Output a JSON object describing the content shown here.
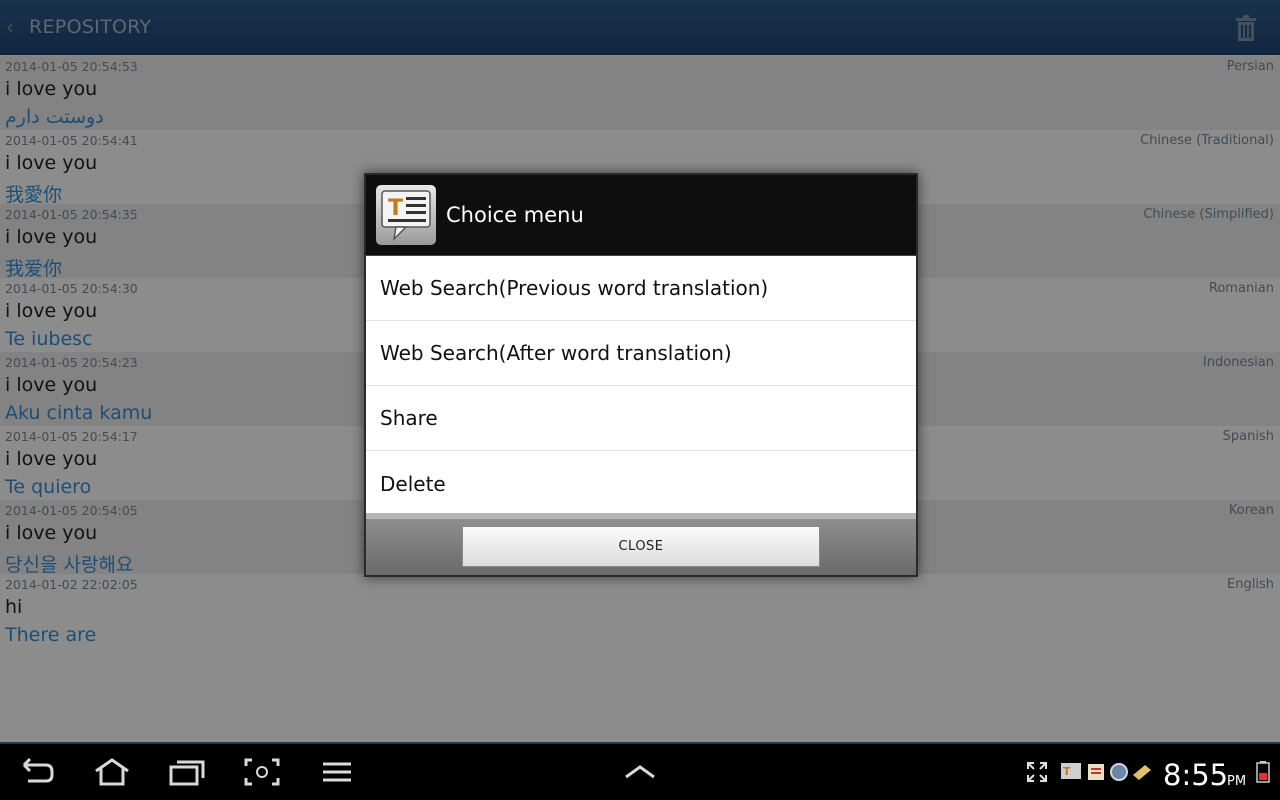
{
  "action_bar": {
    "title": "REPOSITORY",
    "back_icon": "chevron-left-icon",
    "delete_icon": "trash-icon"
  },
  "entries": [
    {
      "timestamp": "2014-01-05 20:54:53",
      "language": "Persian",
      "source": "i love you",
      "translation": "دوستت دارم"
    },
    {
      "timestamp": "2014-01-05 20:54:41",
      "language": "Chinese (Traditional)",
      "source": "i love you",
      "translation": "我愛你"
    },
    {
      "timestamp": "2014-01-05 20:54:35",
      "language": "Chinese (Simplified)",
      "source": "i love you",
      "translation": "我爱你"
    },
    {
      "timestamp": "2014-01-05 20:54:30",
      "language": "Romanian",
      "source": "i love you",
      "translation": "Te iubesc"
    },
    {
      "timestamp": "2014-01-05 20:54:23",
      "language": "Indonesian",
      "source": "i love you",
      "translation": "Aku cinta kamu"
    },
    {
      "timestamp": "2014-01-05 20:54:17",
      "language": "Spanish",
      "source": "i love you",
      "translation": "Te quiero"
    },
    {
      "timestamp": "2014-01-05 20:54:05",
      "language": "Korean",
      "source": "i love you",
      "translation": "당신을 사랑해요"
    },
    {
      "timestamp": "2014-01-02 22:02:05",
      "language": "English",
      "source": "hi",
      "translation": "There are"
    }
  ],
  "dialog": {
    "title": "Choice menu",
    "items": [
      {
        "label": "Web Search(Previous word translation)"
      },
      {
        "label": "Web Search(After word translation)"
      },
      {
        "label": "Share"
      },
      {
        "label": "Delete"
      }
    ],
    "close_label": "CLOSE"
  },
  "system_bar": {
    "time": "8:55",
    "ampm": "PM",
    "nav_icons": [
      "back-icon",
      "home-icon",
      "recent-apps-icon",
      "screenshot-icon",
      "menu-icon",
      "expand-up-icon"
    ]
  },
  "colors": {
    "action_bar": "#2f5c8c",
    "translation_text": "#3a8fd6",
    "dialog_header": "#0e0e0e"
  }
}
